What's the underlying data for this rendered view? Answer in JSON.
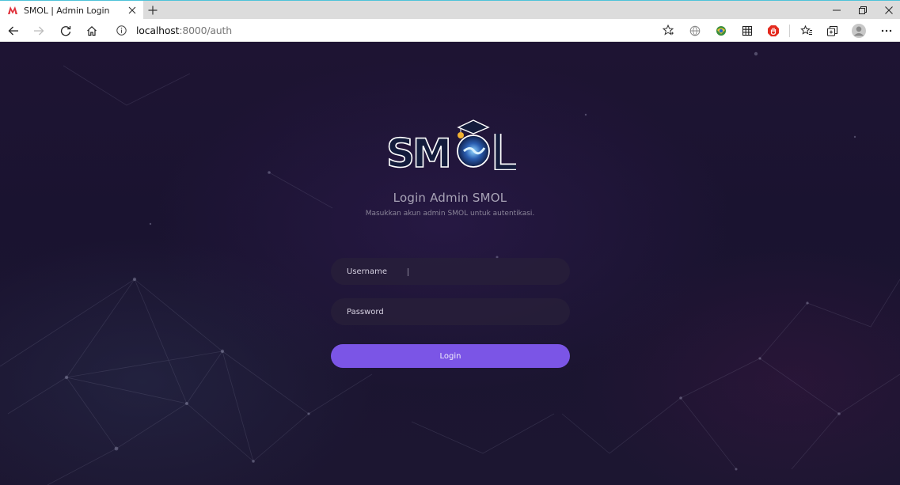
{
  "browser": {
    "tab": {
      "title": "SMOL | Admin Login",
      "close_icon": "close-icon",
      "favicon": "app-logo-icon"
    },
    "new_tab_label": "+",
    "window_controls": [
      "minimize-icon",
      "restore-icon",
      "close-icon"
    ],
    "address_bar": {
      "host": "localhost",
      "path": ":8000/auth"
    },
    "toolbar_icons": [
      "back-icon",
      "forward-icon",
      "refresh-icon",
      "home-icon",
      "info-icon",
      "favorite-star-icon",
      "globe-icon",
      "extension-icon",
      "grid-icon",
      "adblock-icon",
      "favorites-icon",
      "collections-icon",
      "profile-icon",
      "more-icon"
    ]
  },
  "page": {
    "logo_text": "SMOL",
    "title": "Login Admin SMOL",
    "subtitle": "Masukkan akun admin SMOL untuk autentikasi.",
    "username": {
      "placeholder": "Username",
      "value": ""
    },
    "password": {
      "placeholder": "Password",
      "value": ""
    },
    "login_label": "Login"
  },
  "colors": {
    "background": "#1a1430",
    "button": "#7b55e6",
    "field": "#28203a",
    "title_text": "#a8a3b6"
  }
}
